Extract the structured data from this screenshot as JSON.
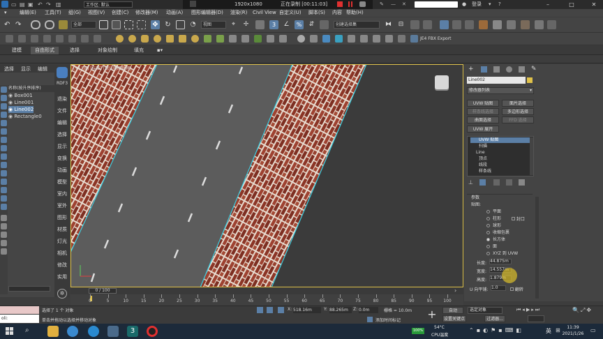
{
  "titlebar": {
    "workspace_label": "工作区: 默认",
    "resolution": "1920x1080",
    "recording": "正在录制 [00:11:03]",
    "login": "登录"
  },
  "menubar": {
    "items": [
      "编辑(E)",
      "工具(T)",
      "组(G)",
      "视图(V)",
      "创建(C)",
      "修改器(M)",
      "动画(A)",
      "图形编辑器(D)",
      "渲染(R)",
      "Civil View",
      "自定义(U)",
      "脚本(S)",
      "内容",
      "帮助(H)"
    ]
  },
  "toolbar1": {
    "select_filter": "全部",
    "view_dropdown": "视图",
    "named_selection": "创建选择集"
  },
  "toolbar2": {
    "fbx_label": "JE4 FBX Export"
  },
  "ribbon": {
    "tabs": [
      "建模",
      "自由形式",
      "选择",
      "对象绘制",
      "填充"
    ]
  },
  "explorer": {
    "menu": [
      "选择",
      "显示",
      "编辑"
    ],
    "header": "名称(按升序排序)",
    "items": [
      {
        "name": "Box001",
        "selected": false
      },
      {
        "name": "Line001",
        "selected": false
      },
      {
        "name": "Line002",
        "selected": true
      },
      {
        "name": "Rectangle0",
        "selected": false
      }
    ]
  },
  "vtab": {
    "badge": "RDF3",
    "labels": [
      "退染",
      "文件",
      "编辑",
      "选择",
      "显示",
      "变换",
      "动画",
      "模型",
      "室内",
      "室外",
      "图形",
      "材质",
      "灯光",
      "相机",
      "修改",
      "实用"
    ]
  },
  "viewport": {
    "label": "[+] [顶] [标准] [默认明暗处理]",
    "slider_label": "0 / 100"
  },
  "cmdpanel": {
    "object_name": "Line002",
    "modifier_list": "修改器列表",
    "buttons": [
      {
        "label": "UVW 贴图",
        "dim": false
      },
      {
        "label": "面片选择",
        "dim": false
      },
      {
        "label": "样条线选择",
        "dim": true
      },
      {
        "label": "多边形选择",
        "dim": false
      },
      {
        "label": "曲面选择",
        "dim": false
      },
      {
        "label": "FFD 选择",
        "dim": true
      },
      {
        "label": "UVW 展开",
        "dim": false
      }
    ],
    "stack": [
      {
        "label": "UVW 贴图",
        "selected": true
      },
      {
        "label": "扫描",
        "selected": false
      },
      {
        "label": "Line",
        "selected": false
      },
      {
        "label": "顶点",
        "selected": false
      },
      {
        "label": "线段",
        "selected": false
      },
      {
        "label": "样条线",
        "selected": false
      }
    ],
    "params_title": "参数",
    "mapping_label": "贴图:",
    "mapping_options": [
      {
        "label": "平面",
        "checked": false
      },
      {
        "label": "柱形",
        "checked": false
      },
      {
        "label": "球形",
        "checked": false
      },
      {
        "label": "收缩包裹",
        "checked": false
      },
      {
        "label": "长方体",
        "checked": true
      },
      {
        "label": "面",
        "checked": false
      },
      {
        "label": "XYZ 到 UVW",
        "checked": false
      }
    ],
    "cap_label": "封口",
    "length_label": "长度:",
    "length_value": "44.875m",
    "width_label": "宽度:",
    "width_value": "14.557m",
    "height_label": "高度:",
    "height_value": "1.879m",
    "u_tile_label": "U 向平铺:",
    "u_tile_value": "1.0",
    "flip_label": "翻转"
  },
  "timeline": {
    "ticks": [
      "0",
      "5",
      "10",
      "15",
      "20",
      "25",
      "30",
      "35",
      "40",
      "45",
      "50",
      "55",
      "60",
      "65",
      "70",
      "75",
      "80",
      "85",
      "90",
      "95",
      "100"
    ]
  },
  "statusbar": {
    "selection": "选择了 1 个 对象",
    "hint": "单击并拖动以选择并移动对象",
    "maxscript_prompt": "oli:",
    "x_label": "X:",
    "x_value": "518.16m",
    "y_label": "Y:",
    "y_value": "88.265m",
    "z_label": "Z:",
    "z_value": "0.0m",
    "grid": "栅格 = 10.0m",
    "add_time_tag": "添加时间标记",
    "auto_key": "自动",
    "selected_object": "选定对象",
    "set_key": "设置关键点",
    "filter": "过滤器..."
  },
  "taskbar": {
    "temperature": "54°C",
    "cpu_label": "CPU温度",
    "battery": "100%",
    "lang": "英",
    "time": "11:39",
    "date": "2021/1/26"
  },
  "colors": {
    "accent_blue": "#5b7fa6",
    "viewport_border": "#e0c24a",
    "rec_red": "#e03030",
    "brick": "#8c3526",
    "cyan_edge": "#39d2e6",
    "road": "#5c5c5c"
  }
}
